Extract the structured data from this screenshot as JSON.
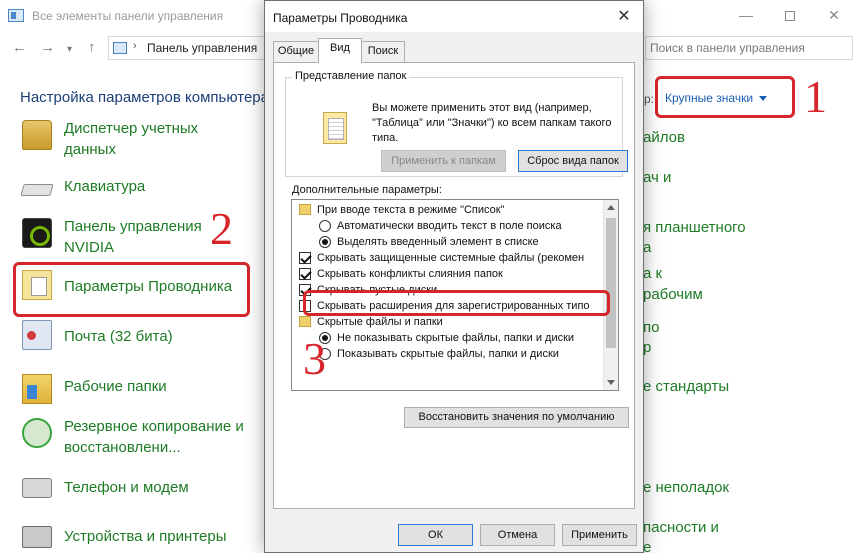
{
  "control_panel": {
    "title": "Все элементы панели управления",
    "breadcrumb": "Панель управления",
    "search_placeholder": "Поиск в панели управления",
    "heading": "Настройка параметров компьютера",
    "view_by_label": "р:",
    "view_value": "Крупные значки",
    "items": [
      {
        "label": "Диспетчер учетных\nданных",
        "icon": "credential-manager-icon"
      },
      {
        "label": "Клавиатура",
        "icon": "keyboard-icon"
      },
      {
        "label": "Панель управления\nNVIDIA",
        "icon": "nvidia-icon"
      },
      {
        "label": "Параметры Проводника",
        "icon": "folder-options-icon"
      },
      {
        "label": "Почта (32 бита)",
        "icon": "mail-icon"
      },
      {
        "label": "Рабочие папки",
        "icon": "work-folders-icon"
      },
      {
        "label": "Резервное копирование и\nвосстановлени...",
        "icon": "backup-icon"
      },
      {
        "label": "Телефон и модем",
        "icon": "phone-modem-icon"
      },
      {
        "label": "Устройства и принтеры",
        "icon": "devices-printers-icon"
      }
    ],
    "right_fragments": [
      "айлов",
      "ач и",
      "я планшетного",
      "а",
      "а к",
      "рабочим",
      "по",
      "р",
      "е стандарты",
      "е неполадок",
      "пасности и",
      "е"
    ]
  },
  "annotations": [
    "1",
    "2",
    "3"
  ],
  "dialog": {
    "title": "Параметры Проводника",
    "close_glyph": "✕",
    "tabs": [
      "Общие",
      "Вид",
      "Поиск"
    ],
    "folder_view": {
      "group_title": "Представление папок",
      "description": "Вы можете применить этот вид (например, \"Таблица\" или \"Значки\") ко всем папкам такого типа.",
      "apply_button": "Применить к папкам",
      "reset_button": "Сброс вида папок"
    },
    "advanced_label": "Дополнительные параметры:",
    "advanced_items": [
      {
        "kind": "folder",
        "indent": 0,
        "label": "При вводе текста в режиме \"Список\""
      },
      {
        "kind": "radio",
        "checked": false,
        "indent": 1,
        "label": "Автоматически вводить текст в поле поиска"
      },
      {
        "kind": "radio",
        "checked": true,
        "indent": 1,
        "label": "Выделять введенный элемент в списке"
      },
      {
        "kind": "check",
        "checked": true,
        "indent": 0,
        "label": "Скрывать защищенные системные файлы (рекомен"
      },
      {
        "kind": "check",
        "checked": true,
        "indent": 0,
        "label": "Скрывать конфликты слияния папок"
      },
      {
        "kind": "check",
        "checked": true,
        "indent": 0,
        "label": "Скрывать пустые диски"
      },
      {
        "kind": "check",
        "checked": false,
        "indent": 0,
        "label": "Скрывать расширения для зарегистрированных типо"
      },
      {
        "kind": "folder",
        "indent": 0,
        "label": "Скрытые файлы и папки"
      },
      {
        "kind": "radio",
        "checked": true,
        "indent": 1,
        "label": "Не показывать скрытые файлы, папки и диски"
      },
      {
        "kind": "radio",
        "checked": false,
        "indent": 1,
        "label": "Показывать скрытые файлы, папки и диски"
      }
    ],
    "restore_button": "Восстановить значения по умолчанию",
    "ok_button": "ОК",
    "cancel_button": "Отмена",
    "apply_button": "Применить"
  },
  "colors": {
    "link_green": "#1e7b26",
    "heading_blue": "#1e3f7a",
    "annotation_red": "#d6262b",
    "accent_blue": "#2b7bd6"
  }
}
